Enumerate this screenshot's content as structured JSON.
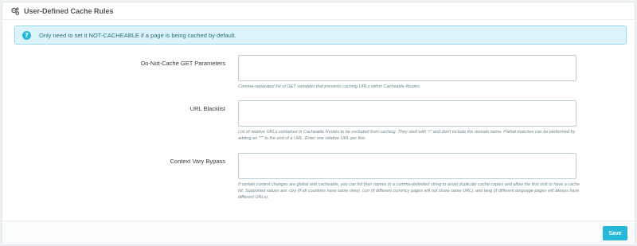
{
  "panel": {
    "title": "User-Defined Cache Rules",
    "icon": "gears-icon"
  },
  "alert": {
    "icon": "question-circle-icon",
    "text": "Only need to set it NOT-CACHEABLE if a page is being cached by default."
  },
  "fields": [
    {
      "label": "Do-Not-Cache GET Parameters",
      "value": "",
      "help": "Comma-separated list of GET variables that prevents caching URLs within Cacheable Routes."
    },
    {
      "label": "URL Blacklist",
      "value": "",
      "help": "List of relative URLs contained in Cacheable Routes to be excluded from caching. They start with \"/\" and don't include the domain name. Partial matches can be performed by adding an \"*\" to the end of a URL. Enter one relative URL per line."
    },
    {
      "label": "Context Vary Bypass",
      "value": "",
      "help": "If certain context changes are global and cacheable, you can list their names in a comma-delimited string to avoid duplicate cache copies and allow the first visit to have a cache hit. Supported values are: ctry (if all countries have same view), curr (if different currency pages will not share same URL), and lang (if different language pages will always have different URLs)."
    }
  ],
  "footer": {
    "save_label": "Save"
  },
  "colors": {
    "accent": "#25b9d7",
    "alert_bg": "#dcf4f9",
    "alert_border": "#99d9e8"
  }
}
